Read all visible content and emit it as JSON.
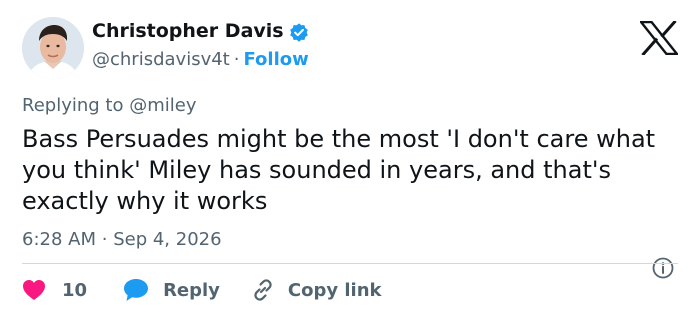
{
  "author": {
    "name": "Christopher Davis",
    "handle": "@chrisdavisv4t",
    "separator": "·",
    "follow_label": "Follow"
  },
  "reply_to": {
    "prefix": "Replying to",
    "handle": "@miley"
  },
  "tweet": {
    "text": "Bass Persuades might be the most 'I don't care what you think' Miley has sounded in years, and that's exactly why it works"
  },
  "meta": {
    "time": "6:28 AM",
    "separator": "·",
    "date": "Sep 4, 2026"
  },
  "actions": {
    "likes": "10",
    "reply_label": "Reply",
    "copy_link_label": "Copy link"
  },
  "colors": {
    "accent": "#1d9bf0",
    "like": "#f91880",
    "text": "#0f1419",
    "muted": "#536471"
  },
  "icons": [
    "verified-badge-icon",
    "x-logo-icon",
    "heart-icon",
    "reply-bubble-icon",
    "link-icon",
    "info-icon"
  ]
}
